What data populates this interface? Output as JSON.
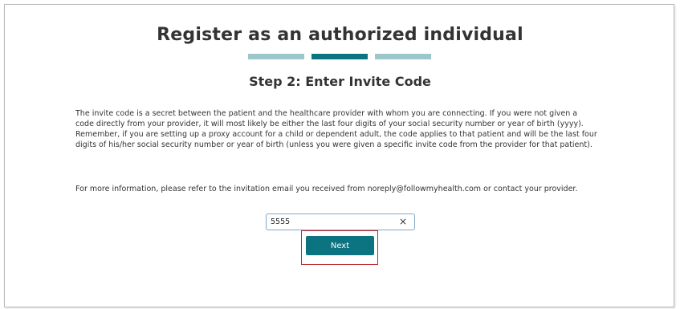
{
  "header": {
    "title": "Register as an authorized individual",
    "progress": {
      "current_step": 2,
      "total_steps": 3,
      "colors": {
        "active": "#0c7480",
        "inactive": "#9bc7cb"
      }
    }
  },
  "step": {
    "title": "Step 2: Enter Invite Code"
  },
  "content": {
    "paragraph1": "The invite code is a secret between the patient and the healthcare provider with whom you are connecting.  If you were not given a code directly from your provider, it will most likely be either the last four digits of your social security number or year of birth (yyyy).  Remember, if you are setting up a proxy account for a child or dependent adult, the code applies to that patient and will be the last four digits of his/her social security number or year of birth (unless you were given a specific invite code from the provider for that patient).",
    "paragraph2": "For more information, please refer to the invitation email you received from noreply@followmyhealth.com or contact your provider."
  },
  "form": {
    "invite_code": {
      "value": "5555",
      "clear_glyph": "×"
    },
    "next_label": "Next"
  },
  "colors": {
    "button": "#0c7480",
    "highlight": "#c0262b",
    "input_border": "#7fa8c9"
  }
}
